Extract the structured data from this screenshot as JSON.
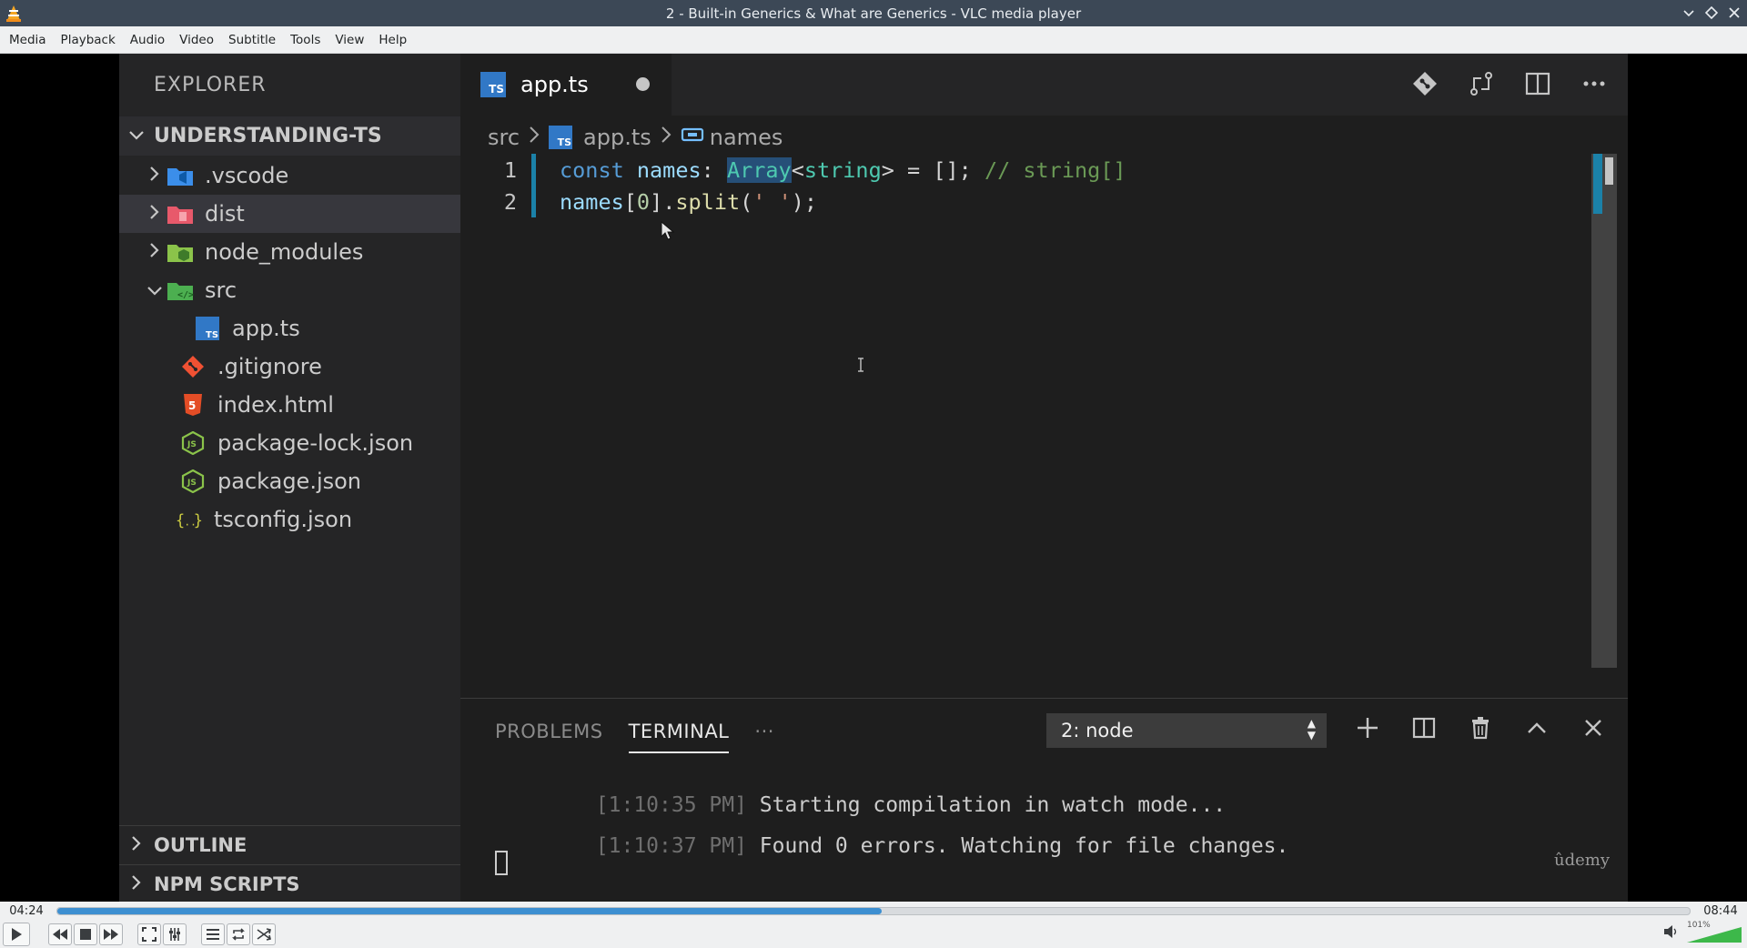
{
  "window": {
    "title": "2 - Built-in Generics & What are Generics - VLC media player"
  },
  "menu": [
    "Media",
    "Playback",
    "Audio",
    "Video",
    "Subtitle",
    "Tools",
    "View",
    "Help"
  ],
  "sidebar": {
    "title": "EXPLORER",
    "project": "UNDERSTANDING-TS",
    "items": [
      {
        "label": ".vscode",
        "icon": "vscode-folder-icon",
        "color": "#3b8eea"
      },
      {
        "label": "dist",
        "icon": "dist-folder-icon",
        "color": "#e8596b"
      },
      {
        "label": "node_modules",
        "icon": "node-folder-icon",
        "color": "#8bc34a"
      },
      {
        "label": "src",
        "icon": "src-folder-icon",
        "color": "#4caf50"
      },
      {
        "label": "app.ts",
        "icon": "typescript-file-icon",
        "color": "#3178c6"
      },
      {
        "label": ".gitignore",
        "icon": "git-file-icon",
        "color": "#f05133"
      },
      {
        "label": "index.html",
        "icon": "html-file-icon",
        "color": "#e44d26"
      },
      {
        "label": "package-lock.json",
        "icon": "node-json-icon",
        "color": "#8bc34a"
      },
      {
        "label": "package.json",
        "icon": "node-json-icon",
        "color": "#8bc34a"
      },
      {
        "label": "tsconfig.json",
        "icon": "json-file-icon",
        "color": "#cbcb41"
      }
    ],
    "outline": "OUTLINE",
    "npm_scripts": "NPM SCRIPTS"
  },
  "editor": {
    "tab_label": "app.ts",
    "ts_badge": "TS",
    "breadcrumb": {
      "folder": "src",
      "file": "app.ts",
      "symbol": "names"
    },
    "line_numbers": [
      "1",
      "2"
    ],
    "line1": {
      "kw": "const ",
      "var": "names",
      "colon": ": ",
      "type": "Array",
      "generic_open": "<",
      "generic_type": "string",
      "generic_close": ">",
      "assign": " = ",
      "arr": "[]",
      "semi": "; ",
      "comment": "// string[]"
    },
    "line2": {
      "var": "names",
      "bracket_open": "[",
      "num": "0",
      "bracket_close": "]",
      "dot": ".",
      "fn": "split",
      "paren_open": "(",
      "str": "' '",
      "paren_close": ");"
    }
  },
  "panel": {
    "tabs": [
      "PROBLEMS",
      "TERMINAL",
      "···"
    ],
    "terminal_select": "2: node",
    "lines": [
      {
        "ts": "[1:10:35 PM]",
        "text": " Starting compilation in watch mode..."
      },
      {
        "ts": "[1:10:37 PM]",
        "text": " Found 0 errors. Watching for file changes."
      }
    ],
    "watermark": "ûdemy"
  },
  "player": {
    "elapsed": "04:24",
    "total": "08:44",
    "progress": 0.505,
    "volume_label": "101%",
    "volume": 1.01
  },
  "colors": {
    "accent": "#1b81a8",
    "seek_fill": "#3d8fd1"
  }
}
